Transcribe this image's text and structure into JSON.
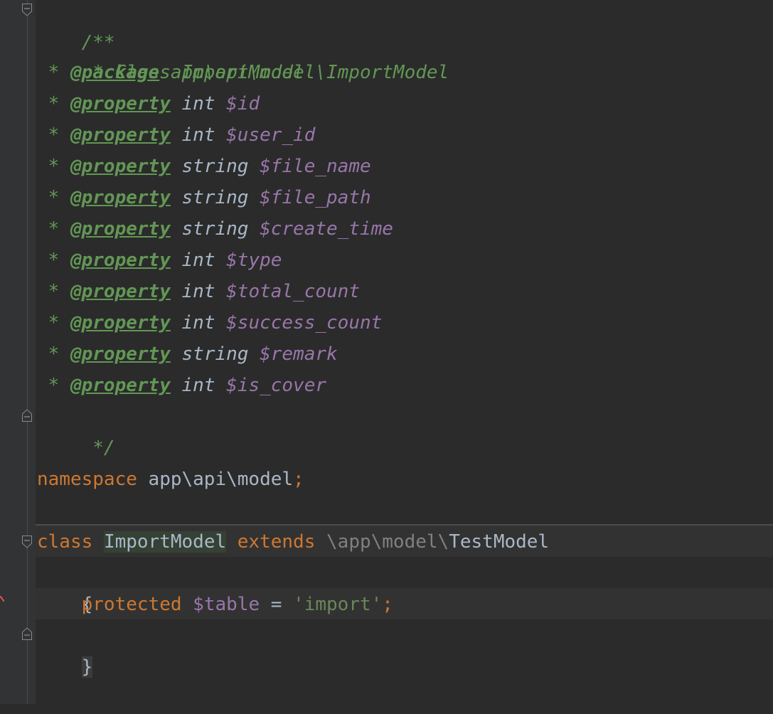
{
  "code": {
    "doc_open": "/**",
    "doc_class": " * Class ImportModel",
    "doc_package_prefix": " * ",
    "doc_package_tag": "@package",
    "doc_package_value": " app\\api\\model\\ImportModel",
    "star": " * ",
    "property_tag": "@property",
    "properties": [
      {
        "type": " int ",
        "name": "$id"
      },
      {
        "type": " int ",
        "name": "$user_id"
      },
      {
        "type": " string ",
        "name": "$file_name"
      },
      {
        "type": " string ",
        "name": "$file_path"
      },
      {
        "type": " string ",
        "name": "$create_time"
      },
      {
        "type": " int ",
        "name": "$type"
      },
      {
        "type": " int ",
        "name": "$total_count"
      },
      {
        "type": " int ",
        "name": "$success_count"
      },
      {
        "type": " string ",
        "name": "$remark"
      },
      {
        "type": " int ",
        "name": "$is_cover"
      }
    ],
    "doc_close": " */",
    "namespace_kw": "namespace",
    "namespace_name": " app\\api\\model",
    "namespace_semicolon": ";",
    "class_kw": "class",
    "class_name": "ImportModel",
    "extends_kw": "extends",
    "parent_ns": "\\app\\model\\",
    "parent_class": "TestModel",
    "brace_open": "{",
    "indent": "    ",
    "protected_kw": "protected",
    "table_var": "$table",
    "assign": " = ",
    "table_value": "'import'",
    "stmt_semicolon": ";",
    "brace_close": "}"
  }
}
